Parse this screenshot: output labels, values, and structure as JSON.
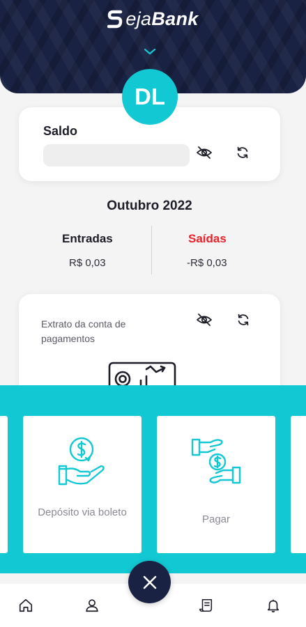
{
  "app": {
    "logo_light": "eja",
    "logo_bold": "Bank",
    "brand_colors": {
      "navy": "#1a2244",
      "teal": "#12c8d3",
      "red": "#e8232a"
    }
  },
  "avatar": {
    "initials": "DL"
  },
  "saldo": {
    "title": "Saldo",
    "hide_icon": "eye-off-icon",
    "refresh_icon": "refresh-icon"
  },
  "summary": {
    "month": "Outubro 2022",
    "entradas_label": "Entradas",
    "entradas_value": "R$ 0,03",
    "saidas_label": "Saídas",
    "saidas_value": "-R$ 0,03"
  },
  "extrato": {
    "label": "Extrato da conta de pagamentos"
  },
  "actions": [
    {
      "label": "Depósito via boleto",
      "icon": "deposit-coin-hand-icon"
    },
    {
      "label": "Pagar",
      "icon": "payment-exchange-icon"
    }
  ],
  "fab": {
    "icon": "close-icon"
  },
  "navbar": [
    {
      "name": "home",
      "icon": "home-icon"
    },
    {
      "name": "profile",
      "icon": "user-icon"
    },
    {
      "name": "statement",
      "icon": "receipt-icon"
    },
    {
      "name": "notifications",
      "icon": "bell-icon"
    }
  ]
}
